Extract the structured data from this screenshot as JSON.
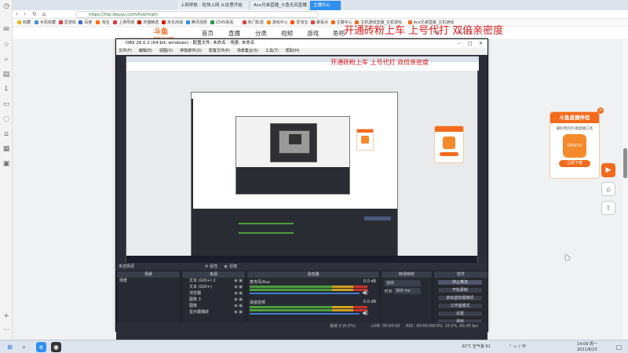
{
  "browser": {
    "tabs": [
      {
        "label": "上网导航 - 轻快上网 从这里开始"
      },
      {
        "label": "Ace兄弟直播_斗鱼无间直播"
      },
      {
        "label": "主播中心",
        "active": true
      }
    ],
    "url": "https://mp.douyu.com/live/main",
    "bookmarks": [
      {
        "label": "收藏",
        "color": "#f2b227"
      },
      {
        "label": "手机收藏",
        "color": "#4a8fd9"
      },
      {
        "label": "爱游戏",
        "color": "#e04343"
      },
      {
        "label": "百度",
        "color": "#3b6cd9"
      },
      {
        "label": "淘宝",
        "color": "#ff6a00"
      },
      {
        "label": "上网导航",
        "color": "#e03b3b"
      },
      {
        "label": "天猫精选",
        "color": "#d81e06"
      },
      {
        "label": "京东商城",
        "color": "#d81e06"
      },
      {
        "label": "腾讯视频",
        "color": "#2c8ff0"
      },
      {
        "label": "2345看看",
        "color": "#2b9a4a"
      },
      {
        "label": "热门影视",
        "color": "#e04343"
      },
      {
        "label": "游戏中心",
        "color": "#f08c1a"
      },
      {
        "label": "爱淘宝",
        "color": "#ff5000"
      },
      {
        "label": "聚看点",
        "color": "#e04343"
      },
      {
        "label": "主播中心",
        "color": "#f26b1d"
      },
      {
        "label": "主机游戏直播_主机游戏",
        "color": "#f26b1d"
      },
      {
        "label": "Ace兄弟直播_主机游戏",
        "color": "#f26b1d"
      }
    ]
  },
  "douyu": {
    "logo": "斗鱼",
    "logo_sub": "DOUYU.COM",
    "nav": [
      "首页",
      "直播",
      "分类",
      "视频",
      "游戏",
      "鱼吧"
    ],
    "promo": "开通砖粉上车 上号代打 双倍亲密度",
    "right": [
      "下载",
      "Ace兄弟"
    ],
    "ad": {
      "title": "斗鱼直播伴侣",
      "subtitle": "最好用的PC端直播工具",
      "logo_text": "DOUYU",
      "button": "立即下载"
    }
  },
  "obs": {
    "title": "OBS 26.0.2 (64-bit, windows) - 配置文件: 未命名 - 场景: 未命名",
    "menu": [
      "文件(F)",
      "编辑(E)",
      "视图(V)",
      "停靠部件(D)",
      "配置文件(P)",
      "场景集合(S)",
      "工具(T)",
      "帮助(H)"
    ],
    "preview_label": "未选择源",
    "props_label": "属性",
    "filters_label": "滤镜",
    "scenes": {
      "header": "场景",
      "items": [
        "场景"
      ]
    },
    "sources": {
      "header": "来源",
      "items": [
        "文本 (GDI+) 2",
        "文本 (GDI+)",
        "浏览器",
        "图像 3",
        "图像",
        "显示器捕获"
      ]
    },
    "mixer": {
      "header": "混音器",
      "items": [
        {
          "name": "麦克风/Aux",
          "db": "0.0 dB"
        },
        {
          "name": "桌面音频",
          "db": "0.0 dB"
        }
      ]
    },
    "transitions": {
      "header": "转场特效",
      "fade": "淡出",
      "duration_label": "时长",
      "duration": "300 ms"
    },
    "controls": {
      "header": "控件",
      "buttons": [
        "停止推流",
        "开始录制",
        "启动虚拟摄像机",
        "工作室模式",
        "设置",
        "退出"
      ]
    },
    "status": {
      "dropped": "丢帧 0 (0.0%)",
      "live": "LIVE: 00:00:00",
      "rec": "REC: 00:00:00",
      "cpu": "CPU: 10.0%, 60.00 fps",
      "kbps": "kb/s"
    }
  },
  "taskbar": {
    "weather": "32°C 空气良 61",
    "time": "14:09 周一",
    "date": "2021/8/23"
  },
  "colors": {
    "accent": "#f26b1d",
    "tab_active": "#2f8ff0",
    "promo": "#e01818"
  }
}
